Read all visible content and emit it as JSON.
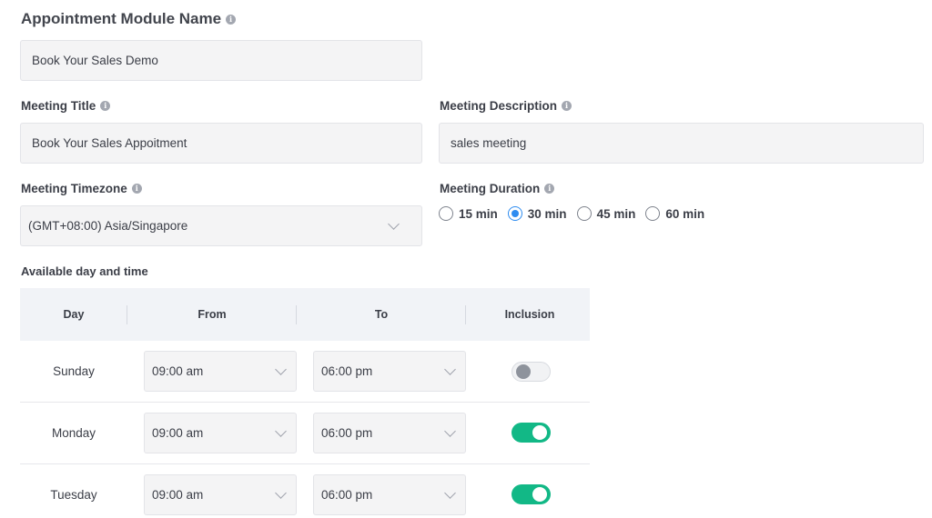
{
  "module": {
    "title": "Appointment Module Name",
    "name_value": "Book Your Sales Demo"
  },
  "meeting_title": {
    "label": "Meeting Title",
    "value": "Book Your Sales Appoitment"
  },
  "meeting_description": {
    "label": "Meeting Description",
    "value": "sales meeting"
  },
  "meeting_timezone": {
    "label": "Meeting Timezone",
    "value": "(GMT+08:00) Asia/Singapore"
  },
  "meeting_duration": {
    "label": "Meeting Duration",
    "options": [
      "15 min",
      "30 min",
      "45 min",
      "60 min"
    ],
    "selected": "30 min"
  },
  "availability": {
    "label": "Available day and time",
    "headers": [
      "Day",
      "From",
      "To",
      "Inclusion"
    ],
    "rows": [
      {
        "day": "Sunday",
        "from": "09:00 am",
        "to": "06:00 pm",
        "included": false
      },
      {
        "day": "Monday",
        "from": "09:00 am",
        "to": "06:00 pm",
        "included": true
      },
      {
        "day": "Tuesday",
        "from": "09:00 am",
        "to": "06:00 pm",
        "included": true
      }
    ]
  },
  "colors": {
    "accent": "#2e8cf0",
    "toggle_on": "#12b886",
    "field_bg": "#f4f4f5",
    "table_header_bg": "#f1f3f7"
  },
  "icons": [
    "info-icon",
    "chevron-down-icon"
  ]
}
